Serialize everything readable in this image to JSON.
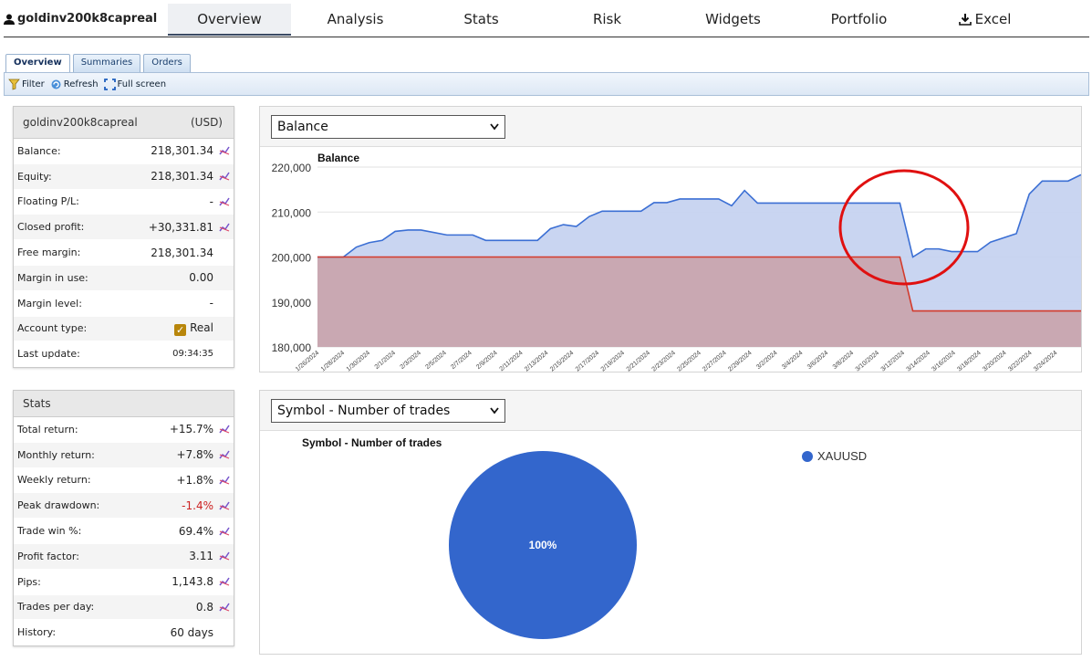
{
  "header": {
    "account_name": "goldinv200k8capreal",
    "tabs": [
      "Overview",
      "Analysis",
      "Stats",
      "Risk",
      "Widgets",
      "Portfolio",
      "Excel"
    ]
  },
  "subtabs": [
    "Overview",
    "Summaries",
    "Orders"
  ],
  "toolbar": {
    "filter": "Filter",
    "refresh": "Refresh",
    "fullscreen": "Full screen"
  },
  "account_panel": {
    "title": "goldinv200k8capreal",
    "currency": "(USD)",
    "rows": [
      {
        "label": "Balance:",
        "value": "218,301.34"
      },
      {
        "label": "Equity:",
        "value": "218,301.34"
      },
      {
        "label": "Floating P/L:",
        "value": "-"
      },
      {
        "label": "Closed profit:",
        "value": "+30,331.81"
      },
      {
        "label": "Free margin:",
        "value": "218,301.34"
      },
      {
        "label": "Margin in use:",
        "value": "0.00"
      },
      {
        "label": "Margin level:",
        "value": "-"
      },
      {
        "label": "Account type:",
        "value": "Real"
      },
      {
        "label": "Last update:",
        "value": "09:34:35"
      }
    ]
  },
  "stats_panel": {
    "title": "Stats",
    "rows": [
      {
        "label": "Total return:",
        "value": "+15.7%"
      },
      {
        "label": "Monthly return:",
        "value": "+7.8%"
      },
      {
        "label": "Weekly return:",
        "value": "+1.8%"
      },
      {
        "label": "Peak drawdown:",
        "value": "-1.4%"
      },
      {
        "label": "Trade win %:",
        "value": "69.4%"
      },
      {
        "label": "Profit factor:",
        "value": "3.11"
      },
      {
        "label": "Pips:",
        "value": "1,143.8"
      },
      {
        "label": "Trades per day:",
        "value": "0.8"
      },
      {
        "label": "History:",
        "value": "60 days"
      }
    ]
  },
  "balance_select": "Balance",
  "symbol_select": "Symbol - Number of trades",
  "colors": {
    "blue_line": "#3b6fd4",
    "blue_fill": "#c6d3f0",
    "red_line": "#d33b2c",
    "red_fill": "#c9a3ab",
    "annotation": "#e01010",
    "pie": "#3366cc"
  },
  "chart_data": [
    {
      "type": "area",
      "title": "Balance",
      "ylim": [
        180000,
        220000
      ],
      "yticks": [
        "220,000",
        "210,000",
        "200,000",
        "190,000",
        "180,000"
      ],
      "xticks": [
        "1/26/2024",
        "1/28/2024",
        "1/30/2024",
        "2/1/2024",
        "2/3/2024",
        "2/5/2024",
        "2/7/2024",
        "2/9/2024",
        "2/11/2024",
        "2/13/2024",
        "2/15/2024",
        "2/17/2024",
        "2/19/2024",
        "2/21/2024",
        "2/23/2024",
        "2/25/2024",
        "2/27/2024",
        "2/29/2024",
        "3/2/2024",
        "3/4/2024",
        "3/6/2024",
        "3/8/2024",
        "3/10/2024",
        "3/12/2024",
        "3/14/2024",
        "3/16/2024",
        "3/18/2024",
        "3/20/2024",
        "3/22/2024",
        "3/24/2024"
      ],
      "series": [
        {
          "name": "",
          "x": [
            "1/26/2024",
            "1/28/2024",
            "1/29/2024",
            "1/30/2024",
            "1/31/2024",
            "2/1/2024",
            "2/2/2024",
            "2/3/2024",
            "2/5/2024",
            "2/6/2024",
            "2/7/2024",
            "2/8/2024",
            "2/9/2024",
            "2/12/2024",
            "2/13/2024",
            "2/14/2024",
            "2/15/2024",
            "2/16/2024",
            "2/17/2024",
            "2/20/2024",
            "2/21/2024",
            "2/22/2024",
            "2/23/2024",
            "2/26/2024",
            "2/27/2024",
            "2/28/2024",
            "2/29/2024",
            "3/1/2024",
            "3/11/2024",
            "3/12/2024",
            "3/13/2024",
            "3/14/2024",
            "3/15/2024",
            "3/16/2024",
            "3/17/2024",
            "3/18/2024",
            "3/20/2024",
            "3/21/2024",
            "3/22/2024",
            "3/24/2024",
            "3/25/2024"
          ],
          "values": [
            200000,
            200000,
            202200,
            203200,
            203700,
            205700,
            206000,
            206000,
            204900,
            204900,
            204900,
            203700,
            203700,
            203700,
            206300,
            207200,
            206800,
            209000,
            210200,
            210200,
            212100,
            212100,
            212900,
            212900,
            211400,
            214800,
            212000,
            212000,
            212000,
            200000,
            201800,
            201800,
            201200,
            201200,
            201200,
            203300,
            205200,
            214000,
            216900,
            216900,
            218300
          ]
        },
        {
          "name": "",
          "x": [
            "1/26/2024",
            "3/11/2024",
            "3/12/2024",
            "3/25/2024"
          ],
          "values": [
            200000,
            200000,
            188000,
            188000
          ]
        }
      ]
    },
    {
      "type": "pie",
      "title": "Symbol - Number of trades",
      "labels": [
        "XAUUSD"
      ],
      "values": [
        100
      ],
      "data_labels": [
        "100%"
      ]
    }
  ]
}
